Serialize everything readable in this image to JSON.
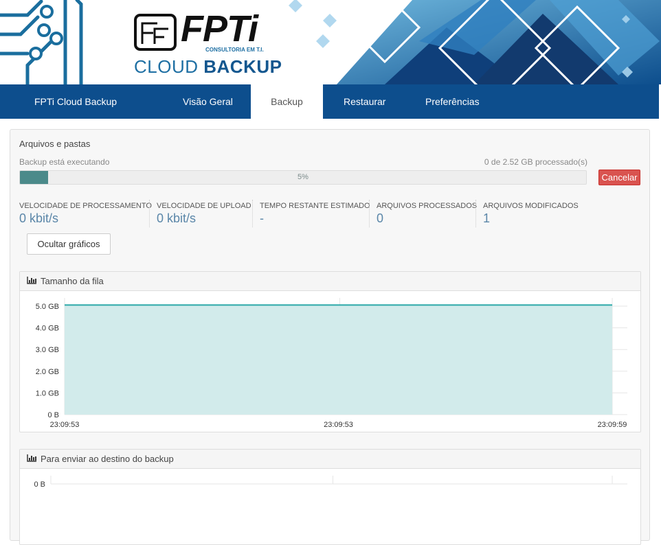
{
  "brand": {
    "name_text": "FPTi",
    "subtitle": "CONSULTORIA EM T.I.",
    "product_light": "CLOUD",
    "product_bold": "BACKUP"
  },
  "nav": {
    "items": [
      {
        "label": "FPTi Cloud Backup",
        "active": false
      },
      {
        "label": "Visão Geral",
        "active": false
      },
      {
        "label": "Backup",
        "active": true
      },
      {
        "label": "Restaurar",
        "active": false
      },
      {
        "label": "Preferências",
        "active": false
      }
    ]
  },
  "backup": {
    "title": "Arquivos e pastas",
    "status": "Backup está executando",
    "processed": "0 de 2.52 GB processado(s)",
    "progress_label": "5%",
    "progress_fraction": 0.05,
    "cancel_label": "Cancelar",
    "hide_charts_label": "Ocultar gráficos",
    "stats": [
      {
        "label": "VELOCIDADE DE PROCESSAMENTO",
        "value": "0 kbit/s"
      },
      {
        "label": "VELOCIDADE DE UPLOAD",
        "value": "0 kbit/s"
      },
      {
        "label": "TEMPO RESTANTE ESTIMADO",
        "value": "-"
      },
      {
        "label": "ARQUIVOS PROCESSADOS",
        "value": "0"
      },
      {
        "label": "ARQUIVOS MODIFICADOS",
        "value": "1"
      }
    ]
  },
  "colors": {
    "nav_bg": "#0d4e8d",
    "accent": "#1e6fa3",
    "progress_fill": "#4b8a8a",
    "cancel": "#d9534f",
    "chart_fill": "#d2ebeb",
    "chart_line": "#2aa7a7"
  },
  "chart_data": [
    {
      "type": "area",
      "title": "Tamanho da fila",
      "x": [
        "23:09:53",
        "23:09:53",
        "23:09:59"
      ],
      "y_ticks": [
        "0 B",
        "1.0 GB",
        "2.0 GB",
        "3.0 GB",
        "4.0 GB",
        "5.0 GB"
      ],
      "ylim": [
        0,
        5.0
      ],
      "series": [
        {
          "values": [
            5.05,
            5.05,
            5.05
          ]
        }
      ],
      "grid": true
    },
    {
      "type": "area",
      "title": "Para enviar ao destino do backup",
      "x": [],
      "y_ticks": [
        "0 B"
      ],
      "ylim": [
        0,
        1
      ],
      "series": [
        {
          "values": []
        }
      ],
      "grid": true
    }
  ]
}
